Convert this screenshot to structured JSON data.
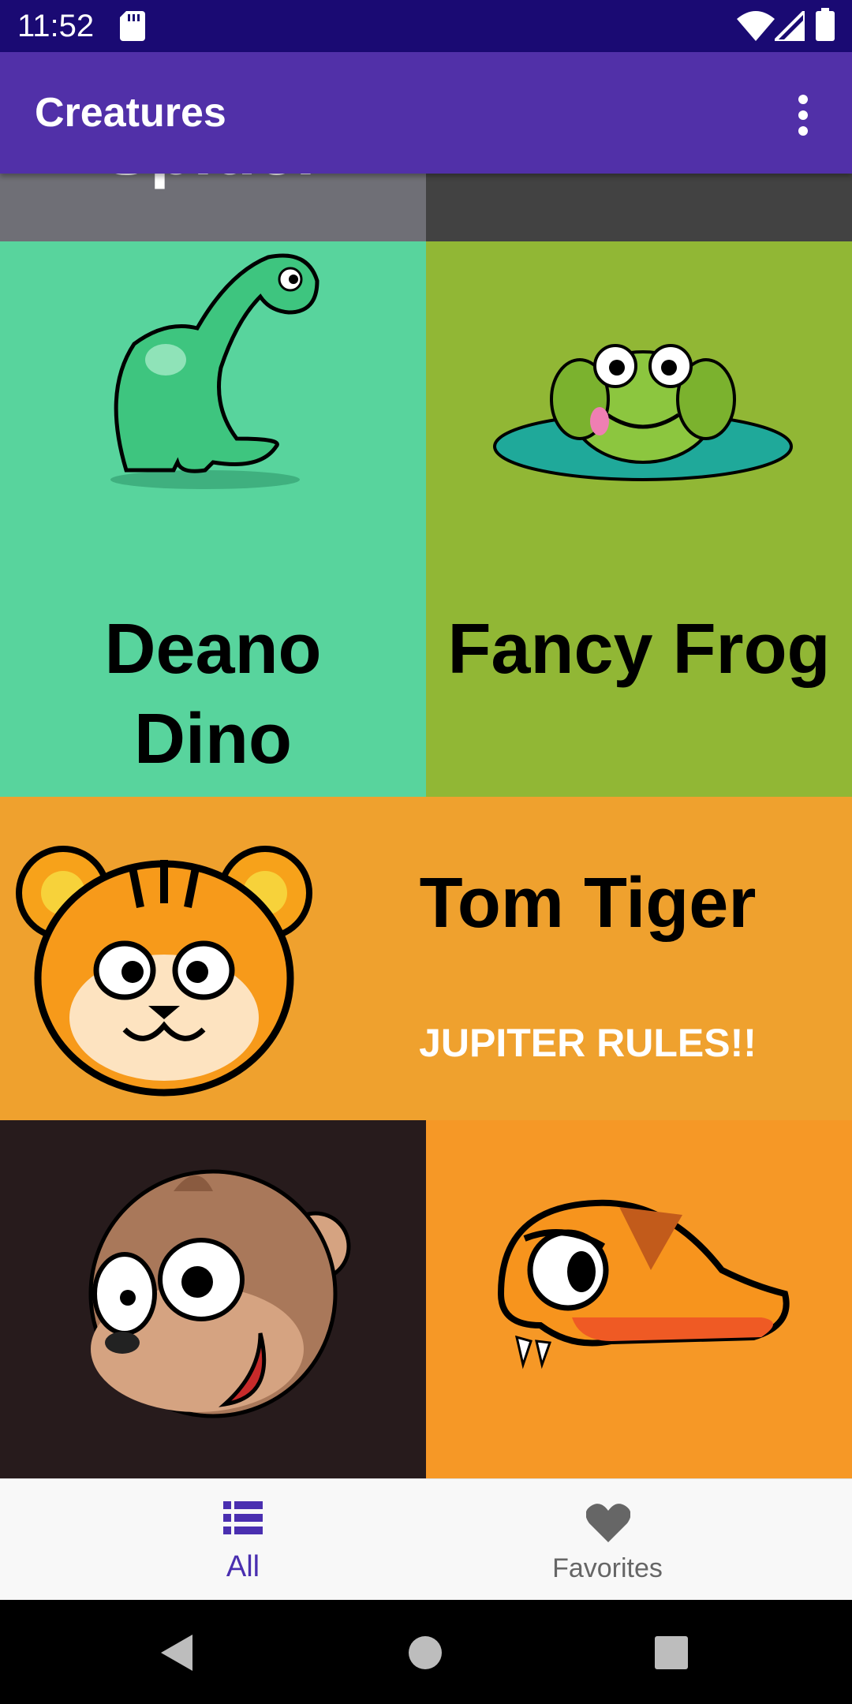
{
  "status_bar": {
    "time": "11:52"
  },
  "app_bar": {
    "title": "Creatures"
  },
  "creatures": {
    "spider": {
      "name": "Spider"
    },
    "dino": {
      "name_line1": "Deano",
      "name_line2": "Dino"
    },
    "frog": {
      "name": "Fancy Frog"
    },
    "tiger": {
      "name": "Tom Tiger",
      "motto": "JUPITER RULES!!"
    }
  },
  "bottom_nav": {
    "items": [
      {
        "label": "All",
        "icon": "list-icon",
        "selected": true
      },
      {
        "label": "Favorites",
        "icon": "heart-icon",
        "selected": false
      }
    ]
  },
  "colors": {
    "status_bar": "#1a0a73",
    "app_bar": "#5130a8",
    "dino_bg": "#58d49d",
    "frog_bg": "#91b735",
    "tiger_bg": "#efa12e",
    "monkey_bg": "#271b1c",
    "snake_bg": "#f69826",
    "nav_selected": "#4a2fb0"
  }
}
